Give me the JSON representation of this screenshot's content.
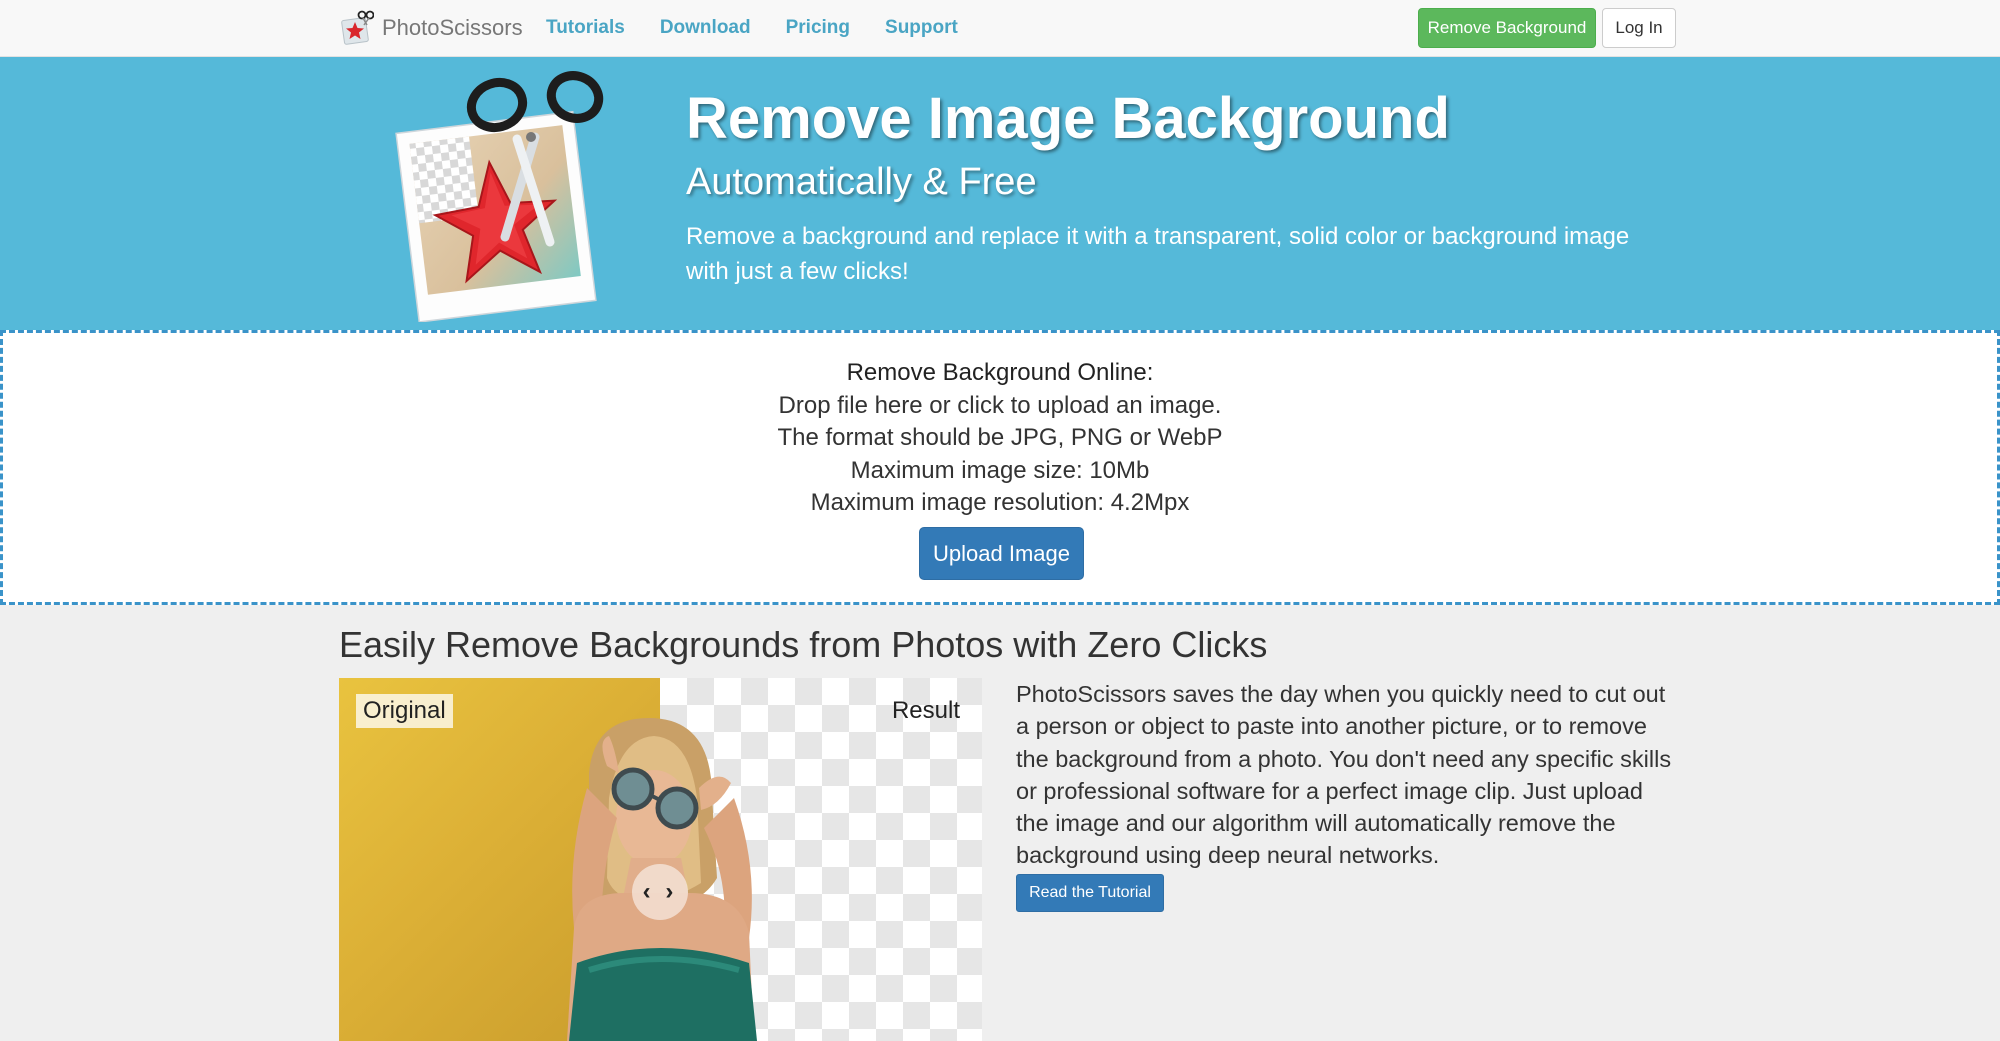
{
  "navbar": {
    "brand": "PhotoScissors",
    "links": [
      "Tutorials",
      "Download",
      "Pricing",
      "Support"
    ],
    "remove_button": "Remove Background",
    "login_button": "Log In"
  },
  "hero": {
    "title": "Remove Image Background",
    "subtitle": "Automatically & Free",
    "description": "Remove a background and replace it with a transparent, solid color or background image with just a few clicks!"
  },
  "upload": {
    "heading": "Remove Background Online:",
    "lines": [
      "Drop file here or click to upload an image.",
      "The format should be JPG, PNG or WebP",
      "Maximum image size: 10Mb",
      "Maximum image resolution: 4.2Mpx"
    ],
    "button": "Upload Image"
  },
  "feature": {
    "title": "Easily Remove Backgrounds from Photos with Zero Clicks",
    "label_original": "Original",
    "label_result": "Result",
    "handle": "‹ ›",
    "description": "PhotoScissors saves the day when you quickly need to cut out a person or object to paste into another picture, or to remove the background from a photo. You don't need any specific skills or professional software for a perfect image clip. Just upload the image and our algorithm will automatically remove the background using deep neural networks.",
    "tutorial_button": "Read the Tutorial"
  },
  "colors": {
    "hero_bg": "#55b9d9",
    "nav_link": "#4aa5c4",
    "success": "#5cb85c",
    "primary": "#337ab7"
  }
}
